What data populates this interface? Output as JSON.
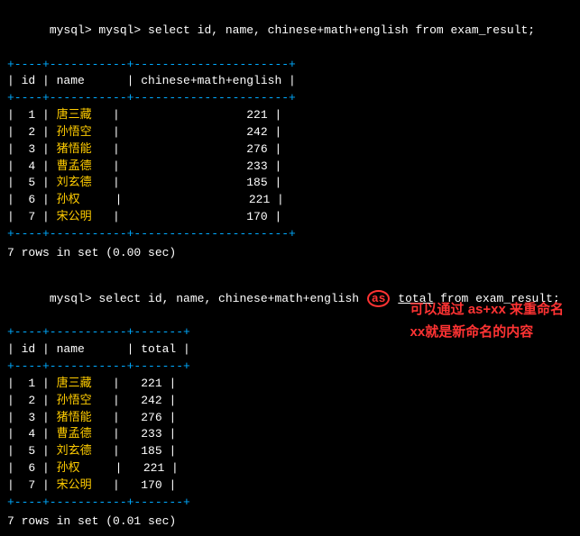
{
  "terminal": {
    "query1": {
      "prompt": "mysql> select id, name, chinese+math+english from exam_result;",
      "table_header_border": "+----+-----------+---------------------+",
      "table_header": "| id | name      | chinese+math+english |",
      "table_divider": "+----+-----------+---------------------+",
      "rows": [
        {
          "id": " 1",
          "name": "唐三藏",
          "value": "221"
        },
        {
          "id": " 2",
          "name": "孙悟空",
          "value": "242"
        },
        {
          "id": " 3",
          "name": "猪悟能",
          "value": "276"
        },
        {
          "id": " 4",
          "name": "曹孟德",
          "value": "233"
        },
        {
          "id": " 5",
          "name": "刘玄德",
          "value": "185"
        },
        {
          "id": " 6",
          "name": "孙权",
          "value": "221"
        },
        {
          "id": " 7",
          "name": "宋公明",
          "value": "170"
        }
      ],
      "footer": "7 rows in set (0.00 sec)"
    },
    "query2": {
      "prompt_pre": "mysql> select id, name, chinese+math+english ",
      "as_word": "as",
      "prompt_mid": " total from exam_result;",
      "total_word": "total",
      "table_header_border": "+----+-----------+-------+",
      "table_header": "| id | name      | total |",
      "table_divider": "+----+-----------+-------+",
      "rows": [
        {
          "id": " 1",
          "name": "唐三藏",
          "value": "221"
        },
        {
          "id": " 2",
          "name": "孙悟空",
          "value": "242"
        },
        {
          "id": " 3",
          "name": "猪悟能",
          "value": "276"
        },
        {
          "id": " 4",
          "name": "曹孟德",
          "value": "233"
        },
        {
          "id": " 5",
          "name": "刘玄德",
          "value": "185"
        },
        {
          "id": " 6",
          "name": "孙权",
          "value": "221"
        },
        {
          "id": " 7",
          "name": "宋公明",
          "value": "170"
        }
      ],
      "footer": "7 rows in set (0.01 sec)"
    },
    "annotation": {
      "line1": "可以通过 as+xx 来重命名",
      "line2": "xx就是新命名的内容"
    }
  }
}
